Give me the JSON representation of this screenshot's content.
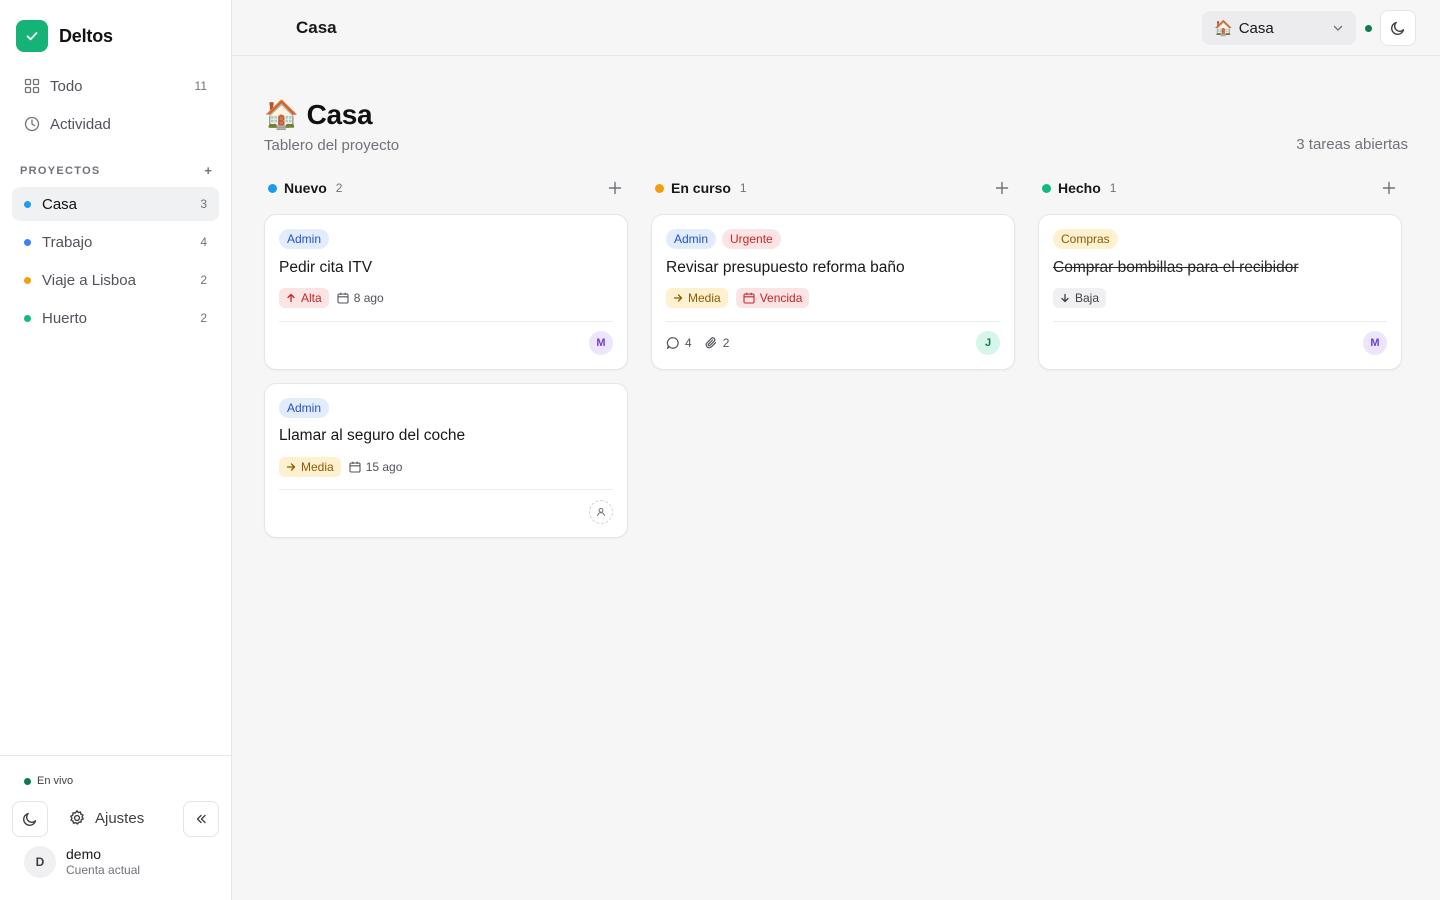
{
  "brand": {
    "name": "Deltos"
  },
  "nav": [
    {
      "label": "Todo",
      "count": "11"
    },
    {
      "label": "Actividad",
      "count": ""
    }
  ],
  "projects_section": {
    "label": "PROYECTOS",
    "add": "+"
  },
  "projects": [
    {
      "name": "Casa",
      "count": "3",
      "color": "#1d9bf0",
      "active": true
    },
    {
      "name": "Trabajo",
      "count": "4",
      "color": "#3b82f6"
    },
    {
      "name": "Viaje a Lisboa",
      "count": "2",
      "color": "#f59e0b"
    },
    {
      "name": "Huerto",
      "count": "2",
      "color": "#10b981"
    }
  ],
  "sidebar_footer": {
    "live_label": "En vivo",
    "settings_label": "Ajustes",
    "user": {
      "initial": "D",
      "name": "demo",
      "subtitle": "Cuenta actual"
    }
  },
  "topbar": {
    "title": "Casa",
    "project_select": {
      "emoji": "🏠",
      "value": "Casa"
    }
  },
  "page": {
    "emoji": "🏠",
    "title": "Casa",
    "subtitle": "Tablero del proyecto",
    "open_count": "3 tareas abiertas"
  },
  "columns": [
    {
      "name": "Nuevo",
      "count": "2",
      "color": "#1d9bf0",
      "cards": [
        {
          "tags": [
            "Admin"
          ],
          "title": "Pedir cita ITV",
          "priority": "Alta",
          "date": "8 ago",
          "assignee": "M"
        },
        {
          "tags": [
            "Admin"
          ],
          "title": "Llamar al seguro del coche",
          "priority": "Media",
          "date": "15 ago",
          "assignee": ""
        }
      ]
    },
    {
      "name": "En curso",
      "count": "1",
      "color": "#f59e0b",
      "cards": [
        {
          "tags": [
            "Admin",
            "Urgente"
          ],
          "title": "Revisar presupuesto reforma baño",
          "priority": "Media",
          "due": "Vencida",
          "comments": "4",
          "attachments": "2",
          "assignee": "J"
        }
      ]
    },
    {
      "name": "Hecho",
      "count": "1",
      "color": "#10b981",
      "cards": [
        {
          "tags": [
            "Compras"
          ],
          "title": "Comprar bombillas para el recibidor",
          "priority": "Baja",
          "assignee": "M",
          "done": true
        }
      ]
    }
  ]
}
